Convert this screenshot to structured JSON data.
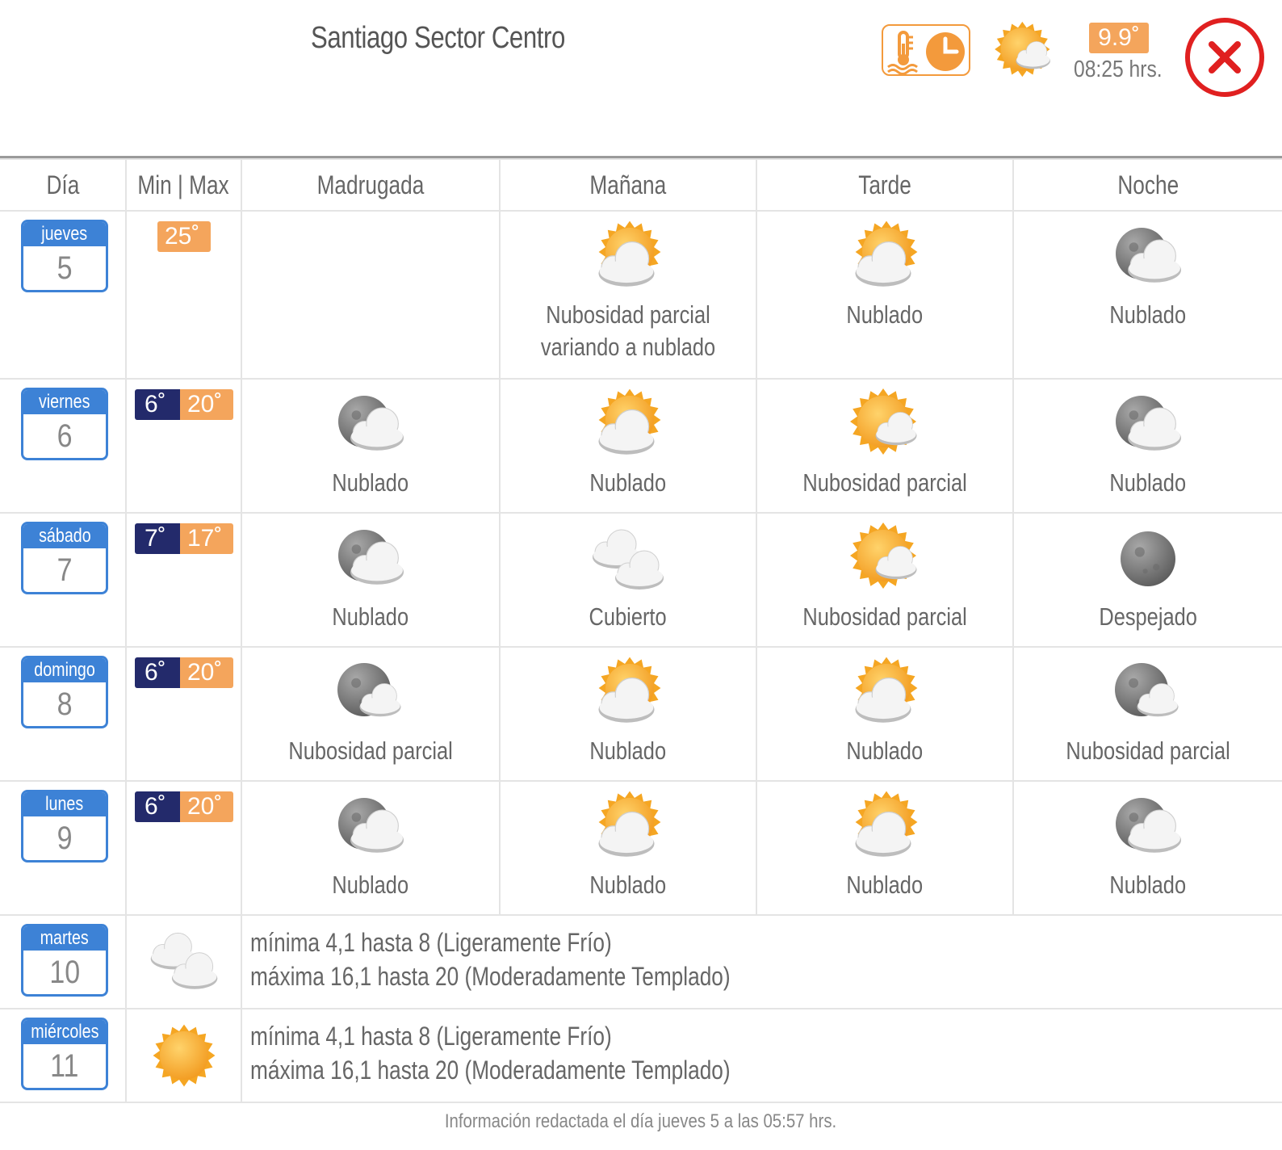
{
  "header": {
    "title": "Santiago Sector Centro",
    "current_temp": "9.9˚",
    "current_time": "08:25 hrs.",
    "current_icon": "sun-cloud-icon",
    "thermo_clock_icon": "thermometer-clock-icon",
    "close_icon": "close-icon"
  },
  "columns": {
    "day": "Día",
    "minmax": "Min | Max",
    "madrugada": "Madrugada",
    "manana": "Mañana",
    "tarde": "Tarde",
    "noche": "Noche"
  },
  "days": [
    {
      "name": "jueves",
      "number": "5",
      "min": "",
      "max": "25˚",
      "periods": [
        {
          "icon": "",
          "text": ""
        },
        {
          "icon": "sun-cloud",
          "text": "Nubosidad parcial variando a nublado"
        },
        {
          "icon": "sun-cloud",
          "text": "Nublado"
        },
        {
          "icon": "moon-cloud",
          "text": "Nublado"
        }
      ]
    },
    {
      "name": "viernes",
      "number": "6",
      "min": "6˚",
      "max": "20˚",
      "periods": [
        {
          "icon": "moon-cloud",
          "text": "Nublado"
        },
        {
          "icon": "sun-cloud",
          "text": "Nublado"
        },
        {
          "icon": "sun-small-cloud",
          "text": "Nubosidad parcial"
        },
        {
          "icon": "moon-cloud",
          "text": "Nublado"
        }
      ]
    },
    {
      "name": "sábado",
      "number": "7",
      "min": "7˚",
      "max": "17˚",
      "periods": [
        {
          "icon": "moon-cloud",
          "text": "Nublado"
        },
        {
          "icon": "clouds",
          "text": "Cubierto"
        },
        {
          "icon": "sun-small-cloud",
          "text": "Nubosidad parcial"
        },
        {
          "icon": "moon",
          "text": "Despejado"
        }
      ]
    },
    {
      "name": "domingo",
      "number": "8",
      "min": "6˚",
      "max": "20˚",
      "periods": [
        {
          "icon": "moon-small-cloud",
          "text": "Nubosidad parcial"
        },
        {
          "icon": "sun-cloud",
          "text": "Nublado"
        },
        {
          "icon": "sun-cloud",
          "text": "Nublado"
        },
        {
          "icon": "moon-small-cloud",
          "text": "Nubosidad parcial"
        }
      ]
    },
    {
      "name": "lunes",
      "number": "9",
      "min": "6˚",
      "max": "20˚",
      "periods": [
        {
          "icon": "moon-cloud",
          "text": "Nublado"
        },
        {
          "icon": "sun-cloud",
          "text": "Nublado"
        },
        {
          "icon": "sun-cloud",
          "text": "Nublado"
        },
        {
          "icon": "moon-cloud",
          "text": "Nublado"
        }
      ]
    }
  ],
  "extended": [
    {
      "name": "martes",
      "number": "10",
      "icon": "clouds",
      "line1": "mínima 4,1 hasta 8 (Ligeramente Frío)",
      "line2": "máxima 16,1 hasta 20 (Moderadamente Templado)"
    },
    {
      "name": "miércoles",
      "number": "11",
      "icon": "sun",
      "line1": "mínima 4,1 hasta 8 (Ligeramente Frío)",
      "line2": "máxima 16,1 hasta 20 (Moderadamente Templado)"
    }
  ],
  "footer": "Información redactada el día jueves 5 a las 05:57 hrs.",
  "colors": {
    "accent_blue": "#3d82d6",
    "min_bg": "#232a6b",
    "max_bg": "#f4a55c",
    "close_red": "#e02020",
    "sun_orange": "#f5a623"
  }
}
